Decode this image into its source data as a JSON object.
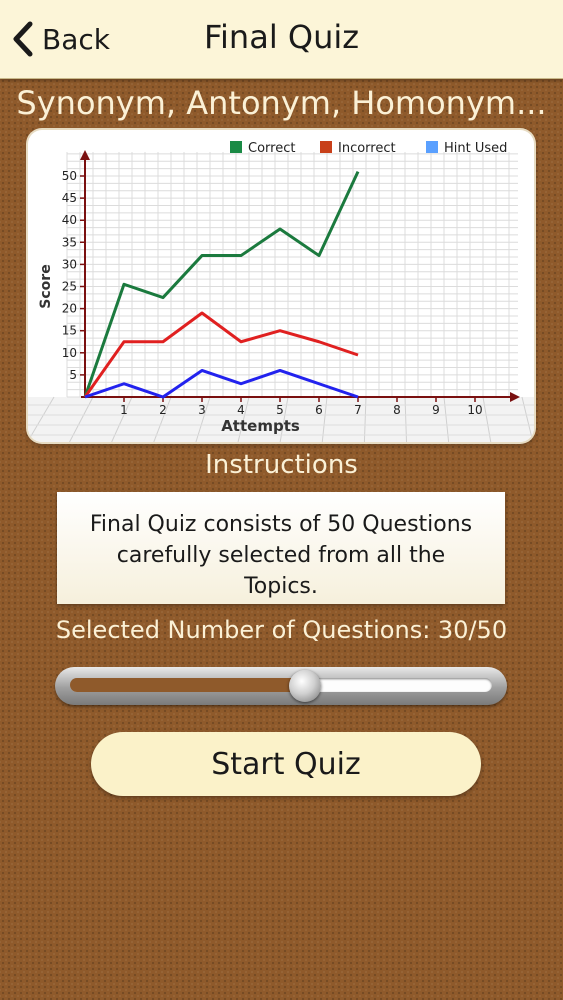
{
  "navbar": {
    "back_label": "Back",
    "title": "Final Quiz"
  },
  "subtitle": "Synonym, Antonym, Homonym...",
  "chart_data": {
    "type": "line",
    "xlabel": "Attempts",
    "ylabel": "Score",
    "x_ticks": [
      1,
      2,
      3,
      4,
      5,
      6,
      7,
      8,
      9,
      10
    ],
    "y_ticks": [
      5,
      10,
      15,
      20,
      25,
      30,
      35,
      40,
      45,
      50
    ],
    "xlim": [
      0,
      10
    ],
    "ylim": [
      0,
      50
    ],
    "legend_position": "top-right",
    "grid": true,
    "x": [
      0,
      1,
      2,
      3,
      4,
      5,
      6,
      7
    ],
    "series": [
      {
        "name": "Correct",
        "color": "#1b7a3e",
        "values": [
          0,
          25.5,
          22.5,
          32,
          32,
          38,
          32,
          51
        ]
      },
      {
        "name": "Incorrect",
        "color": "#e02020",
        "values": [
          0,
          12.5,
          12.5,
          19,
          12.5,
          15,
          12.5,
          9.5
        ]
      },
      {
        "name": "Hint Used",
        "color": "#2222ee",
        "values": [
          0,
          3,
          0,
          6,
          3,
          6,
          3,
          0
        ]
      }
    ],
    "legend_colors": [
      "#1a8a45",
      "#c8401a",
      "#5aa0ff"
    ]
  },
  "instructions": {
    "label": "Instructions",
    "text": "Final Quiz consists of 50 Questions carefully selected from all the Topics."
  },
  "questions": {
    "label": "Selected Number of Questions: 30/50",
    "selected": 30,
    "max": 50
  },
  "start_button": "Start Quiz"
}
